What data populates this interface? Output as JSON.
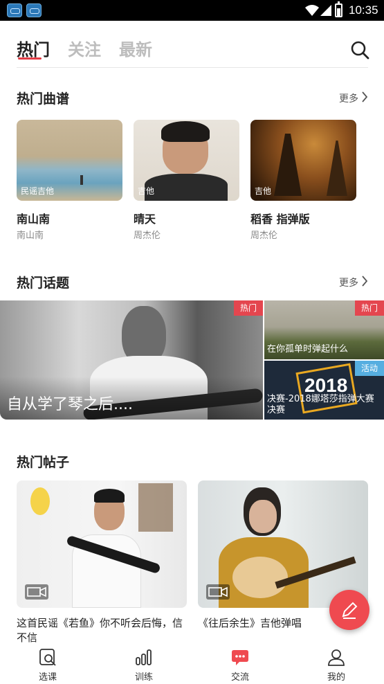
{
  "status_bar": {
    "time": "10:35"
  },
  "top_tabs": [
    {
      "label": "热门",
      "active": true
    },
    {
      "label": "关注",
      "active": false
    },
    {
      "label": "最新",
      "active": false
    }
  ],
  "hot_scores": {
    "title": "热门曲谱",
    "more": "更多",
    "items": [
      {
        "name": "南山南",
        "artist": "南山南",
        "tag": "民谣吉他"
      },
      {
        "name": "晴天",
        "artist": "周杰伦",
        "tag": "吉他"
      },
      {
        "name": "稻香 指弹版",
        "artist": "周杰伦",
        "tag": "吉他"
      }
    ]
  },
  "hot_topics": {
    "title": "热门话题",
    "more": "更多",
    "featured": {
      "title": "自从学了琴之后....",
      "badge": "热门"
    },
    "items": [
      {
        "title": "在你孤单时弹起什么",
        "badge": "热门"
      },
      {
        "title": "决赛-2018娜塔莎指弹大赛决赛",
        "badge": "活动",
        "image_text": "2018"
      }
    ]
  },
  "hot_posts": {
    "title": "热门帖子",
    "items": [
      {
        "title": "这首民谣《若鱼》你不听会后悔，信不信"
      },
      {
        "title": "《往后余生》吉他弹唱"
      }
    ]
  },
  "bottom_nav": [
    {
      "label": "选课",
      "icon": "course-icon"
    },
    {
      "label": "训练",
      "icon": "training-icon"
    },
    {
      "label": "交流",
      "icon": "chat-icon",
      "active": true
    },
    {
      "label": "我的",
      "icon": "profile-icon"
    }
  ],
  "colors": {
    "accent": "#e43c45",
    "event": "#56aee0"
  }
}
